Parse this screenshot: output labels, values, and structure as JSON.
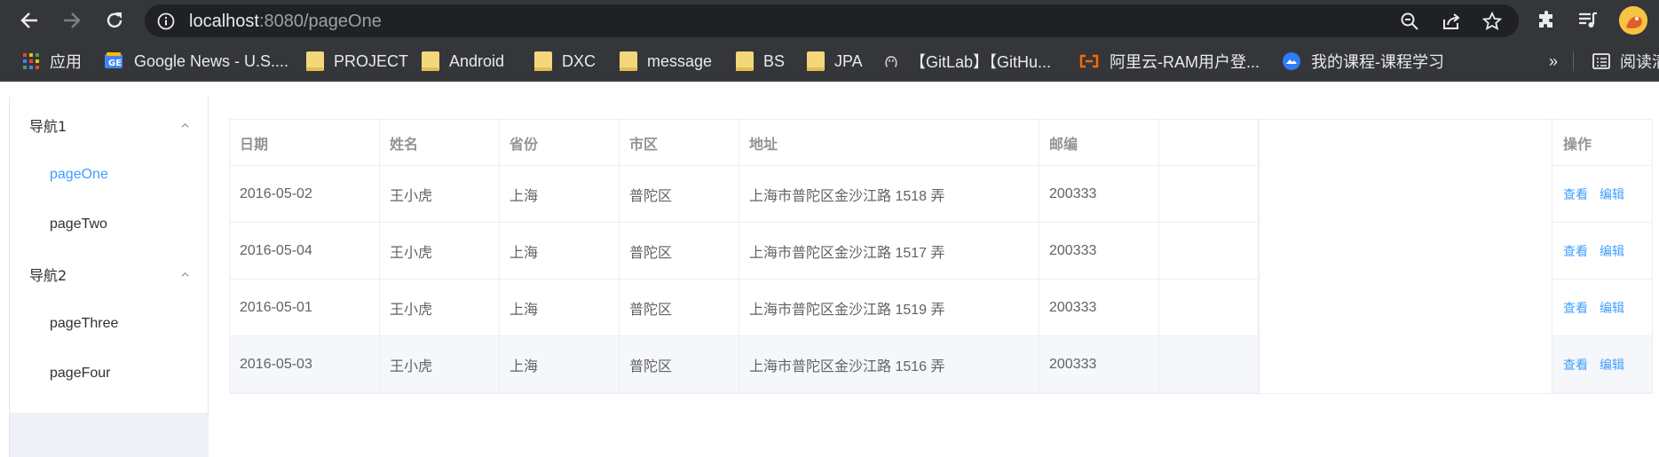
{
  "browser": {
    "url_host": "localhost",
    "url_rest": ":8080/pageOne",
    "bookmarks": [
      {
        "label": "应用",
        "icon": "apps-grid-icon"
      },
      {
        "label": "Google News - U.S....",
        "icon": "google-news-icon"
      },
      {
        "label": "PROJECT",
        "icon": "folder-icon"
      },
      {
        "label": "Android",
        "icon": "folder-icon"
      },
      {
        "label": "DXC",
        "icon": "folder-icon"
      },
      {
        "label": "message",
        "icon": "folder-icon"
      },
      {
        "label": "BS",
        "icon": "folder-icon"
      },
      {
        "label": "JPA",
        "icon": "folder-icon"
      },
      {
        "label": "【GitLab】【GitHu...",
        "icon": "github-icon"
      },
      {
        "label": "阿里云-RAM用户登...",
        "icon": "aliyun-icon"
      },
      {
        "label": "我的课程-课程学习",
        "icon": "course-icon"
      }
    ],
    "overflow_label": "»",
    "reading_list_label": "阅读清"
  },
  "sidebar": {
    "groups": [
      {
        "title": "导航1",
        "items": [
          "pageOne",
          "pageTwo"
        ]
      },
      {
        "title": "导航2",
        "items": [
          "pageThree",
          "pageFour"
        ]
      }
    ],
    "active_item": "pageOne"
  },
  "table": {
    "columns": [
      "日期",
      "姓名",
      "省份",
      "市区",
      "地址",
      "邮编",
      "",
      "操作"
    ],
    "rows": [
      {
        "date": "2016-05-02",
        "name": "王小虎",
        "province": "上海",
        "city": "普陀区",
        "address": "上海市普陀区金沙江路 1518 弄",
        "zip": "200333"
      },
      {
        "date": "2016-05-04",
        "name": "王小虎",
        "province": "上海",
        "city": "普陀区",
        "address": "上海市普陀区金沙江路 1517 弄",
        "zip": "200333"
      },
      {
        "date": "2016-05-01",
        "name": "王小虎",
        "province": "上海",
        "city": "普陀区",
        "address": "上海市普陀区金沙江路 1519 弄",
        "zip": "200333"
      },
      {
        "date": "2016-05-03",
        "name": "王小虎",
        "province": "上海",
        "city": "普陀区",
        "address": "上海市普陀区金沙江路 1516 弄",
        "zip": "200333"
      }
    ],
    "actions": {
      "view": "查看",
      "edit": "编辑"
    },
    "hovered_row": 3
  },
  "colors": {
    "accent": "#409eff",
    "chrome": "#35363a",
    "header_text": "#909399"
  }
}
